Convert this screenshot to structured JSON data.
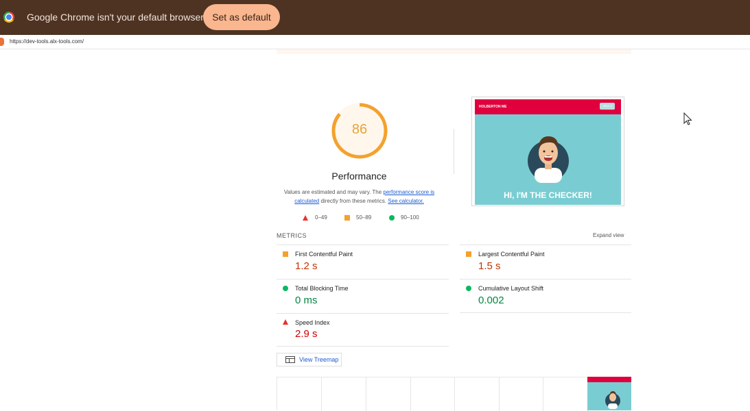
{
  "infobar": {
    "message": "Google Chrome isn't your default browser",
    "set_default_label": "Set as default"
  },
  "url": "https://dev-tools.alx-tools.com/",
  "performance": {
    "score": "86",
    "title": "Performance",
    "desc_prefix": "Values are estimated and may vary. The ",
    "desc_link1": "performance score is calculated",
    "desc_middle": " directly from these metrics. ",
    "desc_link2": "See calculator.",
    "legend": [
      {
        "range": "0–49",
        "icon": "triangle-icon",
        "color": "#e8322c"
      },
      {
        "range": "50–89",
        "icon": "square-icon",
        "color": "#f4a12e"
      },
      {
        "range": "90–100",
        "icon": "circle-icon",
        "color": "#0cb85f"
      }
    ]
  },
  "screenshot": {
    "brand": "HOLBERTON ME",
    "button": "HELLO",
    "headline": "HI, I'M THE CHECKER!"
  },
  "metrics": {
    "label": "METRICS",
    "expand_label": "Expand view",
    "items": [
      {
        "name": "First Contentful Paint",
        "value": "1.2 s",
        "status": "average",
        "color": "#c33300"
      },
      {
        "name": "Largest Contentful Paint",
        "value": "1.5 s",
        "status": "average",
        "color": "#c33300"
      },
      {
        "name": "Total Blocking Time",
        "value": "0 ms",
        "status": "pass",
        "color": "#018642"
      },
      {
        "name": "Cumulative Layout Shift",
        "value": "0.002",
        "status": "pass",
        "color": "#018642"
      },
      {
        "name": "Speed Index",
        "value": "2.9 s",
        "status": "fail",
        "color": "#cc0000"
      }
    ]
  },
  "treemap": {
    "label": "View Treemap"
  },
  "colors": {
    "infobar_bg": "#4e3322",
    "button_bg": "#f9b68f",
    "score_average": "#e8a33a",
    "link": "#1a5ad0"
  }
}
